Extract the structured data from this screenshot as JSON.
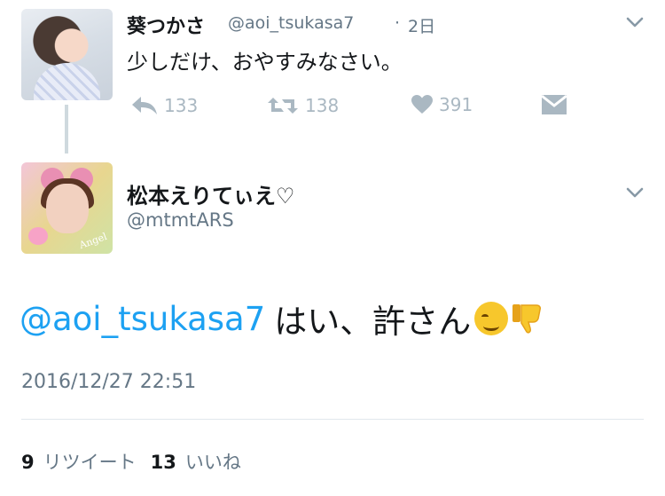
{
  "parent_tweet": {
    "display_name": "葵つかさ",
    "handle": "@aoi_tsukasa7",
    "separator": "·",
    "time": "2日",
    "text": "少しだけ、おやすみなさい。",
    "actions": {
      "reply_count": "133",
      "retweet_count": "138",
      "like_count": "391"
    },
    "icons": [
      "reply-icon",
      "retweet-icon",
      "heart-icon",
      "direct-message-icon",
      "chevron-down-icon"
    ]
  },
  "main_tweet": {
    "display_name": "松本えりてぃえ♡",
    "handle": "@mtmtARS",
    "avatar_text": "Angel",
    "mention": "@aoi_tsukasa7",
    "text": "はい、許さん",
    "emojis": [
      "relieved-smile-emoji",
      "thumbs-down-emoji"
    ],
    "timestamp": "2016/12/27 22:51",
    "retweet_count": "9",
    "retweet_label": "リツイート",
    "like_count": "13",
    "like_label": "いいね"
  },
  "colors": {
    "link": "#1da1f2",
    "secondary_text": "#657786",
    "icon_gray": "#aab8c2",
    "thread_line": "#cfd9de"
  }
}
